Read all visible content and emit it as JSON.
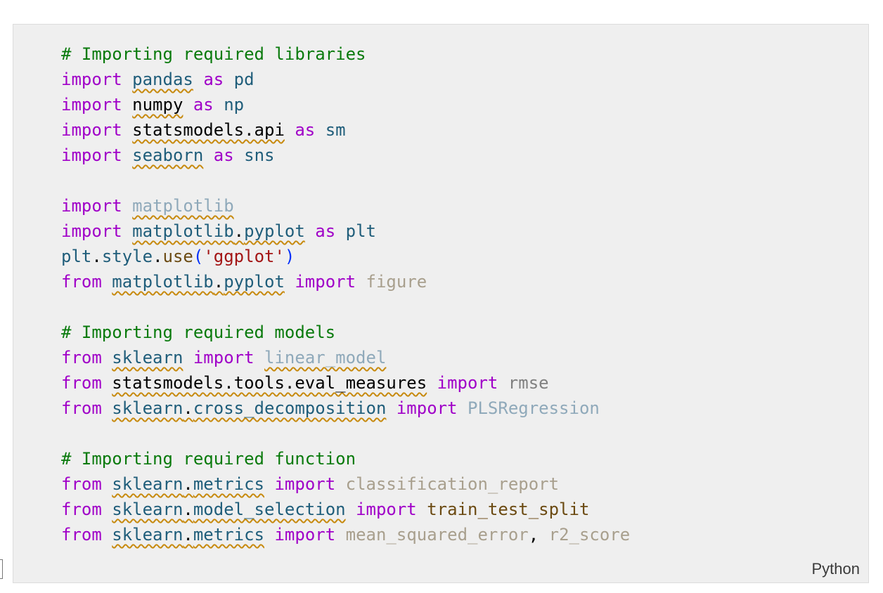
{
  "cell": {
    "language": "Python",
    "lines": [
      [
        {
          "t": "# Importing required libraries",
          "c": "cmt"
        }
      ],
      [
        {
          "t": "import",
          "c": "kw"
        },
        {
          "t": " "
        },
        {
          "t": "pandas",
          "c": "mod",
          "sq": true
        },
        {
          "t": " "
        },
        {
          "t": "as",
          "c": "kw"
        },
        {
          "t": " "
        },
        {
          "t": "pd",
          "c": "alias"
        }
      ],
      [
        {
          "t": "import",
          "c": "kw"
        },
        {
          "t": " "
        },
        {
          "t": "numpy",
          "c": "plain",
          "sq": true
        },
        {
          "t": " "
        },
        {
          "t": "as",
          "c": "kw"
        },
        {
          "t": " "
        },
        {
          "t": "np",
          "c": "alias"
        }
      ],
      [
        {
          "t": "import",
          "c": "kw"
        },
        {
          "t": " "
        },
        {
          "t": "statsmodels.api",
          "c": "plain",
          "sq": true
        },
        {
          "t": " "
        },
        {
          "t": "as",
          "c": "kw"
        },
        {
          "t": " "
        },
        {
          "t": "sm",
          "c": "alias"
        }
      ],
      [
        {
          "t": "import",
          "c": "kw"
        },
        {
          "t": " "
        },
        {
          "t": "seaborn",
          "c": "mod",
          "sq": true
        },
        {
          "t": " "
        },
        {
          "t": "as",
          "c": "kw"
        },
        {
          "t": " "
        },
        {
          "t": "sns",
          "c": "alias"
        }
      ],
      [],
      [
        {
          "t": "import",
          "c": "kw"
        },
        {
          "t": " "
        },
        {
          "t": "matplotlib",
          "c": "unres",
          "sq": true
        }
      ],
      [
        {
          "t": "import",
          "c": "kw"
        },
        {
          "t": " "
        },
        {
          "t": "matplotlib",
          "c": "mod",
          "sq": true
        },
        {
          "t": ".",
          "c": "plain",
          "sq": true
        },
        {
          "t": "pyplot",
          "c": "mod",
          "sq": true
        },
        {
          "t": " "
        },
        {
          "t": "as",
          "c": "kw"
        },
        {
          "t": " "
        },
        {
          "t": "plt",
          "c": "alias"
        }
      ],
      [
        {
          "t": "plt",
          "c": "alias"
        },
        {
          "t": ".",
          "c": "plain"
        },
        {
          "t": "style",
          "c": "alias"
        },
        {
          "t": ".",
          "c": "plain"
        },
        {
          "t": "use",
          "c": "fn"
        },
        {
          "t": "(",
          "c": "paren"
        },
        {
          "t": "'ggplot'",
          "c": "str"
        },
        {
          "t": ")",
          "c": "paren"
        }
      ],
      [
        {
          "t": "from",
          "c": "kw"
        },
        {
          "t": " "
        },
        {
          "t": "matplotlib",
          "c": "mod",
          "sq": true
        },
        {
          "t": ".",
          "c": "plain",
          "sq": true
        },
        {
          "t": "pyplot",
          "c": "mod",
          "sq": true
        },
        {
          "t": " "
        },
        {
          "t": "import",
          "c": "kw"
        },
        {
          "t": " "
        },
        {
          "t": "figure",
          "c": "faded"
        }
      ],
      [],
      [
        {
          "t": "# Importing required models",
          "c": "cmt"
        }
      ],
      [
        {
          "t": "from",
          "c": "kw"
        },
        {
          "t": " "
        },
        {
          "t": "sklearn",
          "c": "mod",
          "sq": true
        },
        {
          "t": " "
        },
        {
          "t": "import",
          "c": "kw"
        },
        {
          "t": " "
        },
        {
          "t": "linear_model",
          "c": "unres",
          "sq": true
        }
      ],
      [
        {
          "t": "from",
          "c": "kw"
        },
        {
          "t": " "
        },
        {
          "t": "statsmodels.tools.eval_measures",
          "c": "plain",
          "sq": true
        },
        {
          "t": " "
        },
        {
          "t": "import",
          "c": "kw"
        },
        {
          "t": " "
        },
        {
          "t": "rmse",
          "c": "gray"
        }
      ],
      [
        {
          "t": "from",
          "c": "kw"
        },
        {
          "t": " "
        },
        {
          "t": "sklearn",
          "c": "mod",
          "sq": true
        },
        {
          "t": ".",
          "c": "plain",
          "sq": true
        },
        {
          "t": "cross_decomposition",
          "c": "mod",
          "sq": true
        },
        {
          "t": " "
        },
        {
          "t": "import",
          "c": "kw"
        },
        {
          "t": " "
        },
        {
          "t": "PLSRegression",
          "c": "unres"
        }
      ],
      [],
      [
        {
          "t": "# Importing required function",
          "c": "cmt"
        }
      ],
      [
        {
          "t": "from",
          "c": "kw"
        },
        {
          "t": " "
        },
        {
          "t": "sklearn",
          "c": "mod",
          "sq": true
        },
        {
          "t": ".",
          "c": "plain",
          "sq": true
        },
        {
          "t": "metrics",
          "c": "mod",
          "sq": true
        },
        {
          "t": " "
        },
        {
          "t": "import",
          "c": "kw"
        },
        {
          "t": " "
        },
        {
          "t": "classification_report",
          "c": "faded"
        }
      ],
      [
        {
          "t": "from",
          "c": "kw"
        },
        {
          "t": " "
        },
        {
          "t": "sklearn",
          "c": "mod",
          "sq": true
        },
        {
          "t": ".",
          "c": "plain",
          "sq": true
        },
        {
          "t": "model_selection",
          "c": "mod",
          "sq": true
        },
        {
          "t": " "
        },
        {
          "t": "import",
          "c": "kw"
        },
        {
          "t": " "
        },
        {
          "t": "train_test_split",
          "c": "fn"
        }
      ],
      [
        {
          "t": "from",
          "c": "kw"
        },
        {
          "t": " "
        },
        {
          "t": "sklearn",
          "c": "mod",
          "sq": true
        },
        {
          "t": ".",
          "c": "plain",
          "sq": true
        },
        {
          "t": "metrics",
          "c": "mod",
          "sq": true
        },
        {
          "t": " "
        },
        {
          "t": "import",
          "c": "kw"
        },
        {
          "t": " "
        },
        {
          "t": "mean_squared_error",
          "c": "faded"
        },
        {
          "t": ", ",
          "c": "plain"
        },
        {
          "t": "r2_score",
          "c": "faded"
        }
      ]
    ]
  }
}
